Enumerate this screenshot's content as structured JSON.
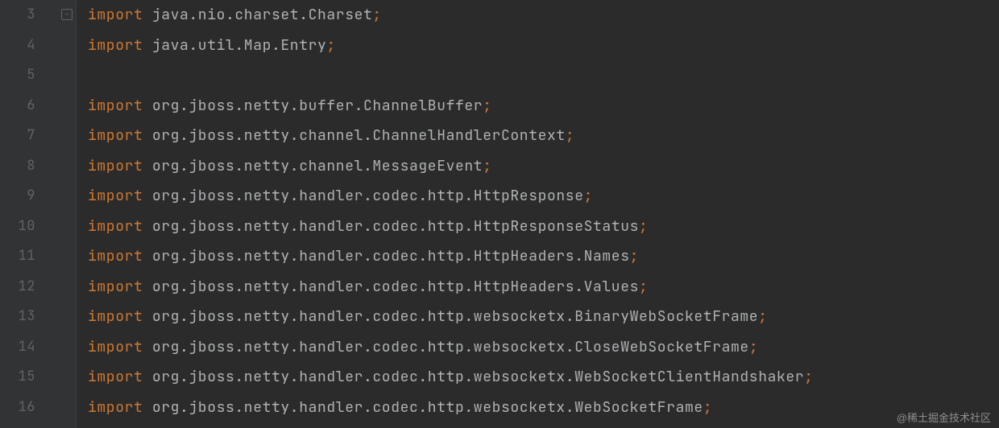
{
  "editor": {
    "first_line_number": 3,
    "lines": [
      {
        "kind": "import",
        "text": "java.nio.charset.Charset"
      },
      {
        "kind": "import",
        "text": "java.util.Map.Entry"
      },
      {
        "kind": "blank",
        "text": ""
      },
      {
        "kind": "import",
        "text": "org.jboss.netty.buffer.ChannelBuffer"
      },
      {
        "kind": "import",
        "text": "org.jboss.netty.channel.ChannelHandlerContext"
      },
      {
        "kind": "import",
        "text": "org.jboss.netty.channel.MessageEvent"
      },
      {
        "kind": "import",
        "text": "org.jboss.netty.handler.codec.http.HttpResponse"
      },
      {
        "kind": "import",
        "text": "org.jboss.netty.handler.codec.http.HttpResponseStatus"
      },
      {
        "kind": "import",
        "text": "org.jboss.netty.handler.codec.http.HttpHeaders.Names"
      },
      {
        "kind": "import",
        "text": "org.jboss.netty.handler.codec.http.HttpHeaders.Values"
      },
      {
        "kind": "import",
        "text": "org.jboss.netty.handler.codec.http.websocketx.BinaryWebSocketFrame"
      },
      {
        "kind": "import",
        "text": "org.jboss.netty.handler.codec.http.websocketx.CloseWebSocketFrame"
      },
      {
        "kind": "import",
        "text": "org.jboss.netty.handler.codec.http.websocketx.WebSocketClientHandshaker"
      },
      {
        "kind": "import",
        "text": "org.jboss.netty.handler.codec.http.websocketx.WebSocketFrame"
      }
    ],
    "keyword_import": "import",
    "fold_marker_line": 3
  },
  "watermark": "@稀土掘金技术社区"
}
